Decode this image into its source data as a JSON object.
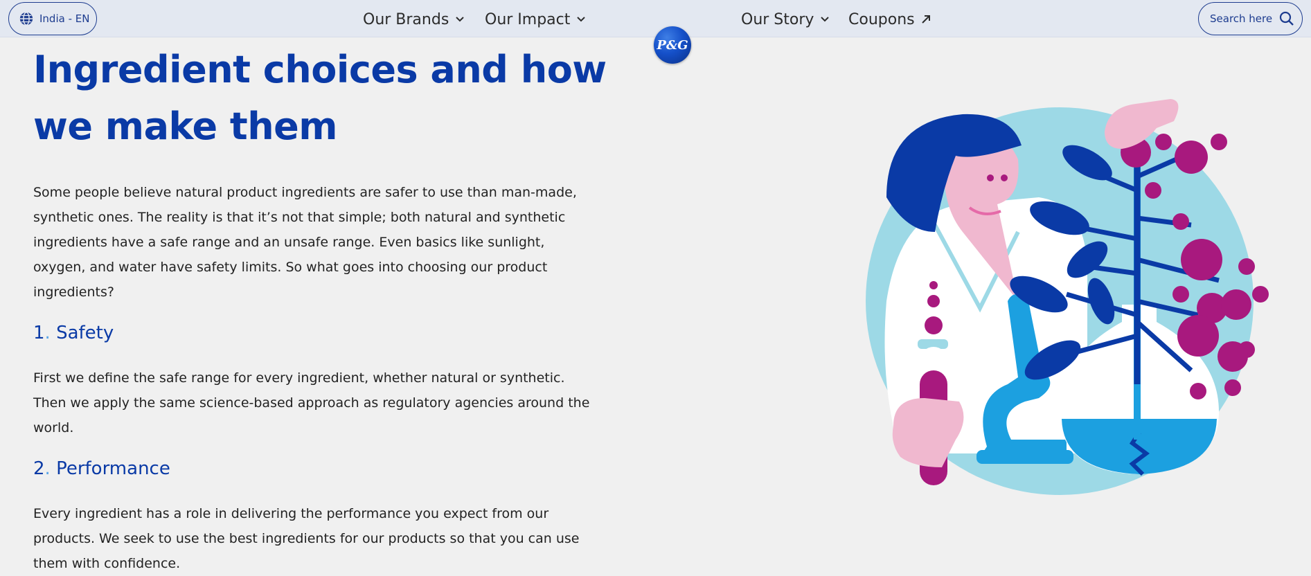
{
  "header": {
    "locale_label": "India - EN",
    "nav": [
      {
        "label": "Our Brands",
        "icon": "chevron-down-icon"
      },
      {
        "label": "Our Impact",
        "icon": "chevron-down-icon"
      },
      {
        "label": "Our Story",
        "icon": "chevron-down-icon"
      },
      {
        "label": "Coupons",
        "icon": "external-arrow-icon"
      }
    ],
    "search_label": "Search here",
    "logo_text": "P&G"
  },
  "main": {
    "title": "Ingredient choices and how we make them",
    "intro": "Some people believe natural product ingredients are safer to use than man-made, synthetic ones. The reality is that it’s not that simple; both natural and synthetic ingredients have a safe range and an unsafe range. Even basics like sunlight, oxygen, and water have safety limits. So what goes into choosing our product ingredients?",
    "sections": [
      {
        "number": "1",
        "dot": ".",
        "title": "Safety",
        "body": "First we define the safe range for every ingredient, whether natural or synthetic. Then we apply the same science-based approach as regulatory agencies around the world."
      },
      {
        "number": "2",
        "dot": ".",
        "title": "Performance",
        "body": "Every ingredient has a role in delivering the performance you expect from our products. We seek to use the best ingredients for our products so that you can use them with confidence."
      }
    ]
  },
  "colors": {
    "brand_blue": "#0a3aa6",
    "accent_magenta": "#a8197e",
    "accent_pink": "#f0b8cf",
    "accent_light_blue": "#9dd9e6",
    "page_background": "#f0f0f0"
  }
}
